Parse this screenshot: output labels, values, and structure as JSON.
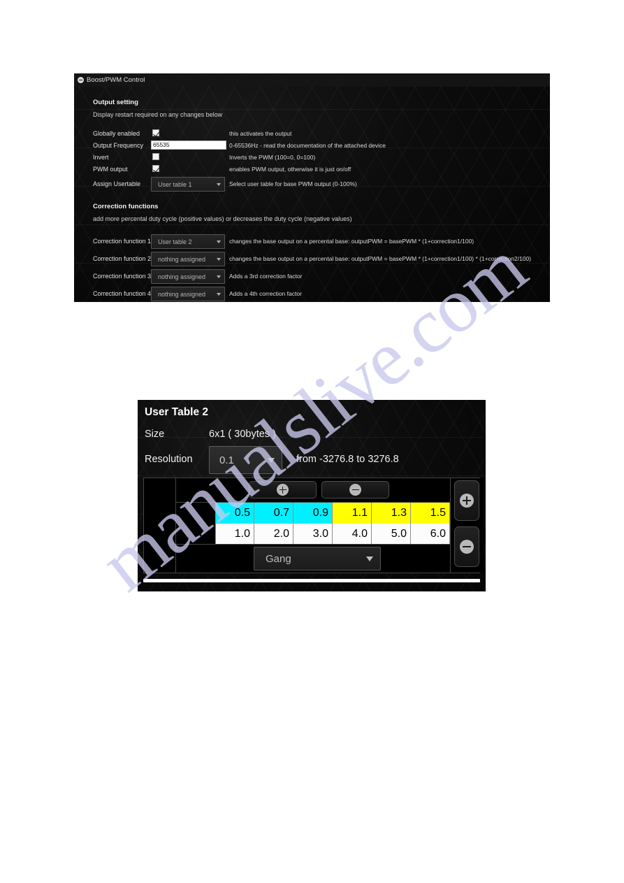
{
  "watermark": {
    "text": "manualslive.com"
  },
  "pwm_panel": {
    "title": "Boost/PWM Control",
    "collapse_icon": "collapse-circle-minus-icon",
    "output_setting": {
      "heading": "Output setting",
      "subheading": "Display restart required on any changes below"
    },
    "rows": [
      {
        "label": "Globally enabled",
        "control": "checkbox",
        "checked": true,
        "description": "this activates the output"
      },
      {
        "label": "Output Frequency",
        "control": "textfield",
        "value": "65535",
        "description": "0-65536Hz - read the documentation of the attached device"
      },
      {
        "label": "Invert",
        "control": "checkbox",
        "checked": false,
        "description": "Inverts the PWM (100=0, 0=100)"
      },
      {
        "label": "PWM output",
        "control": "checkbox",
        "checked": true,
        "description": "enables PWM output, otherwise it is just on/off"
      },
      {
        "label": "Assign Usertable",
        "control": "dropdown",
        "value": "User table 1",
        "description": "Select user table for base PWM output (0-100%)"
      }
    ],
    "correction": {
      "heading": "Correction functions",
      "subheading": "add more percental duty cycle (positive values) or decreases the duty cycle (negative values)",
      "rows": [
        {
          "label": "Correction function 1",
          "value": "User table 2",
          "description": "changes the base output on a percental base: outputPWM = basePWM * (1+correction1/100)"
        },
        {
          "label": "Correction function 2",
          "value": "nothing assigned",
          "description": "changes the base output on a percental base: outputPWM = basePWM * (1+correction1/100) * (1+correction2/100)"
        },
        {
          "label": "Correction function 3",
          "value": "nothing assigned",
          "description": "Adds a 3rd correction factor"
        },
        {
          "label": "Correction function 4",
          "value": "nothing assigned",
          "description": "Adds a 4th correction factor"
        }
      ]
    }
  },
  "user_table_panel": {
    "title": "User Table 2",
    "size_label": "Size",
    "size_value": "6x1 ( 30bytes )",
    "resolution_label": "Resolution",
    "resolution_value": "0.1",
    "resolution_range": "from -3276.8 to 3276.8",
    "add_column_button": "add-column-icon",
    "remove_column_button": "remove-column-icon",
    "add_row_button": "add-row-icon",
    "remove_row_button": "remove-row-icon",
    "gang_dropdown_value": "Gang",
    "grid": {
      "input_row": {
        "values": [
          "0.5",
          "0.7",
          "0.9",
          "1.1",
          "1.3",
          "1.5"
        ],
        "colors": [
          "#00f0ff",
          "#00f0ff",
          "#00f0ff",
          "#ffff00",
          "#ffff00",
          "#ffff00"
        ]
      },
      "output_row": {
        "values": [
          "1.0",
          "2.0",
          "3.0",
          "4.0",
          "5.0",
          "6.0"
        ],
        "colors": [
          "#fcfcfc",
          "#fcfcfc",
          "#fcfcfc",
          "#fcfcfc",
          "#fcfcfc",
          "#fcfcfc"
        ]
      }
    }
  }
}
